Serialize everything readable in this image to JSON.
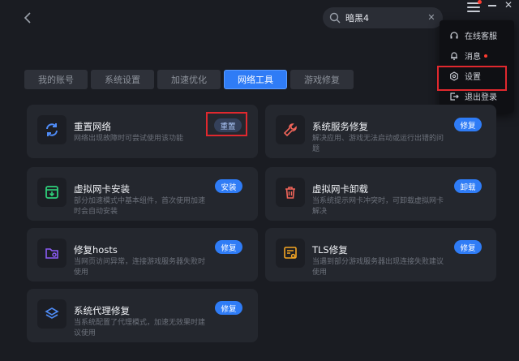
{
  "search": {
    "value": "暗黑4"
  },
  "dropdown": {
    "items": [
      {
        "label": "在线客服",
        "icon": "headset-icon"
      },
      {
        "label": "消息",
        "icon": "bell-icon",
        "badge": true
      },
      {
        "label": "设置",
        "icon": "settings-icon",
        "highlighted": true
      },
      {
        "label": "退出登录",
        "icon": "logout-icon"
      }
    ]
  },
  "tabs": [
    {
      "label": "我的账号"
    },
    {
      "label": "系统设置"
    },
    {
      "label": "加速优化"
    },
    {
      "label": "网络工具",
      "active": true
    },
    {
      "label": "游戏修复"
    }
  ],
  "cards": [
    {
      "title": "重置网络",
      "desc": "网络出现故障时可尝试使用该功能",
      "button": "重置",
      "icon": "refresh-icon",
      "color": "#4f8cf7"
    },
    {
      "title": "系统服务修复",
      "desc": "解决应用、游戏无法启动或运行出错的问题",
      "button": "修复",
      "icon": "wrench-icon",
      "color": "#f2655a"
    },
    {
      "title": "虚拟网卡安装",
      "desc": "部分加速模式中基本组件，首次使用加速时会自动安装",
      "button": "安装",
      "icon": "download-icon",
      "color": "#2ecf7a"
    },
    {
      "title": "虚拟网卡卸载",
      "desc": "当系统提示网卡冲突时，可卸载虚拟网卡解决",
      "button": "卸载",
      "icon": "trash-icon",
      "color": "#f2655a"
    },
    {
      "title": "修复hosts",
      "desc": "当网页访问异常，连接游戏服务器失败时使用",
      "button": "修复",
      "icon": "folder-gear-icon",
      "color": "#8b5cf6"
    },
    {
      "title": "TLS修复",
      "desc": "当遇到部分游戏服务器出现连接失败建议使用",
      "button": "修复",
      "icon": "certificate-icon",
      "color": "#f5a623"
    },
    {
      "title": "系统代理修复",
      "desc": "当系统配置了代理模式，加速无效果时建议使用",
      "button": "修复",
      "icon": "layers-icon",
      "color": "#4f8cf7"
    }
  ]
}
